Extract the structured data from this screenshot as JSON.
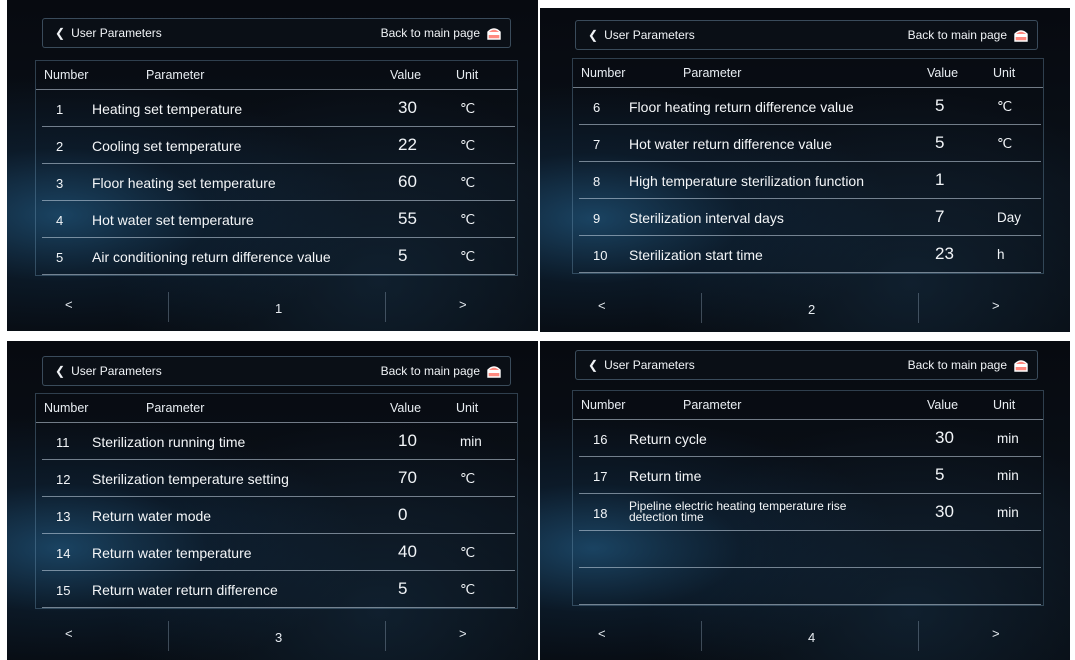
{
  "header": {
    "title": "User Parameters",
    "back_to_main": "Back to main page"
  },
  "columns": {
    "number": "Number",
    "parameter": "Parameter",
    "value": "Value",
    "unit": "Unit"
  },
  "pager": {
    "prev": "<",
    "next": ">"
  },
  "pages": [
    {
      "page_number": "1",
      "rows": [
        {
          "num": "1",
          "param": "Heating set temperature",
          "value": "30",
          "unit": "℃"
        },
        {
          "num": "2",
          "param": "Cooling set temperature",
          "value": "22",
          "unit": "℃"
        },
        {
          "num": "3",
          "param": "Floor heating set temperature",
          "value": "60",
          "unit": "℃"
        },
        {
          "num": "4",
          "param": "Hot water set temperature",
          "value": "55",
          "unit": "℃"
        },
        {
          "num": "5",
          "param": "Air conditioning return difference value",
          "value": "5",
          "unit": "℃"
        }
      ]
    },
    {
      "page_number": "2",
      "rows": [
        {
          "num": "6",
          "param": "Floor heating return difference value",
          "value": "5",
          "unit": "℃"
        },
        {
          "num": "7",
          "param": "Hot water return difference value",
          "value": "5",
          "unit": "℃"
        },
        {
          "num": "8",
          "param": "High temperature sterilization function",
          "value": "1",
          "unit": ""
        },
        {
          "num": "9",
          "param": "Sterilization interval days",
          "value": "7",
          "unit": "Day"
        },
        {
          "num": "10",
          "param": "Sterilization start time",
          "value": "23",
          "unit": "h"
        }
      ]
    },
    {
      "page_number": "3",
      "rows": [
        {
          "num": "11",
          "param": "Sterilization running time",
          "value": "10",
          "unit": "min"
        },
        {
          "num": "12",
          "param": "Sterilization temperature setting",
          "value": "70",
          "unit": "℃"
        },
        {
          "num": "13",
          "param": "Return water mode",
          "value": "0",
          "unit": ""
        },
        {
          "num": "14",
          "param": "Return water temperature",
          "value": "40",
          "unit": "℃"
        },
        {
          "num": "15",
          "param": "Return water return difference",
          "value": "5",
          "unit": "℃"
        }
      ]
    },
    {
      "page_number": "4",
      "rows": [
        {
          "num": "16",
          "param": "Return cycle",
          "value": "30",
          "unit": "min"
        },
        {
          "num": "17",
          "param": "Return time",
          "value": "5",
          "unit": "min"
        },
        {
          "num": "18",
          "param": "Pipeline electric heating temperature rise detection time",
          "value": "30",
          "unit": "min"
        },
        {
          "num": "",
          "param": "",
          "value": "",
          "unit": ""
        },
        {
          "num": "",
          "param": "",
          "value": "",
          "unit": ""
        }
      ]
    }
  ]
}
